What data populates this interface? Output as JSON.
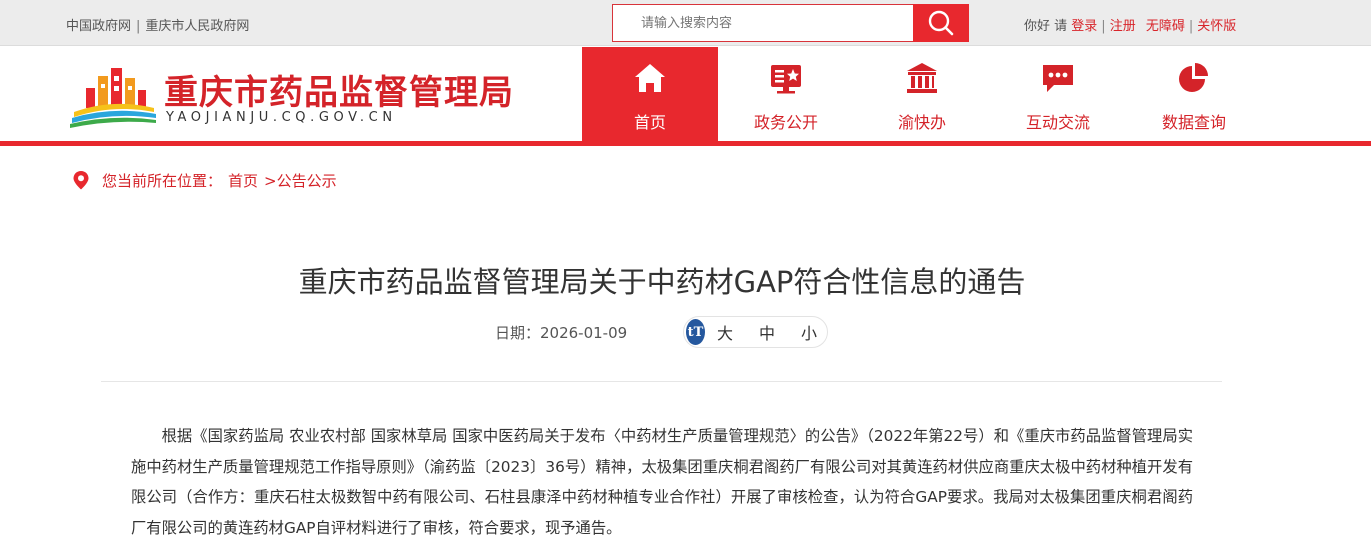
{
  "topbar": {
    "links": [
      "中国政府网",
      "重庆市人民政府网"
    ],
    "search_placeholder": "请输入搜索内容",
    "greeting": "你好 请",
    "login": "登录",
    "register": "注册",
    "accessibility": "无障碍",
    "care_mode": "关怀版"
  },
  "header": {
    "site_title": "重庆市药品监督管理局",
    "site_domain": "YAOJIANJU.CQ.GOV.CN",
    "nav": [
      {
        "label": "首页",
        "icon": "home-icon",
        "active": true
      },
      {
        "label": "政务公开",
        "icon": "public-affairs-icon"
      },
      {
        "label": "渝快办",
        "icon": "government-building-icon"
      },
      {
        "label": "互动交流",
        "icon": "chat-icon"
      },
      {
        "label": "数据查询",
        "icon": "pie-chart-icon"
      }
    ]
  },
  "breadcrumb": {
    "prefix": "您当前所在位置：",
    "home": "首页",
    "current": ">公告公示"
  },
  "article": {
    "title": "重庆市药品监督管理局关于中药材GAP符合性信息的通告",
    "date": "日期：2026-01-09",
    "font_sizes": [
      "大",
      "中",
      "小"
    ],
    "font_icon": "tT",
    "paragraph": "根据《国家药监局 农业农村部 国家林草局 国家中医药局关于发布〈中药材生产质量管理规范〉的公告》（2022年第22号）和《重庆市药品监督管理局实施中药材生产质量管理规范工作指导原则》（渝药监〔2023〕36号）精神，太极集团重庆桐君阁药厂有限公司对其黄连药材供应商重庆太极中药材种植开发有限公司（合作方：重庆石柱太极数智中药有限公司、石柱县康泽中药材种植专业合作社）开展了审核检查，认为符合GAP要求。我局对太极集团重庆桐君阁药厂有限公司的黄连药材GAP自评材料进行了审核，符合要求，现予通告。"
  },
  "colors": {
    "brand_red": "#e8282e",
    "title_red": "#d42329",
    "font_badge_blue": "#25589e"
  }
}
